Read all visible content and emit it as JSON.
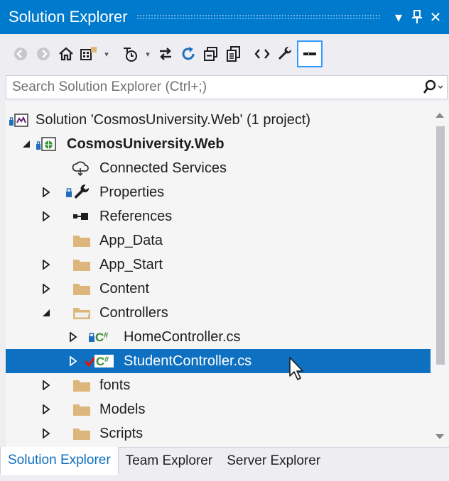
{
  "window": {
    "title": "Solution Explorer",
    "buttons": {
      "dropdown": "▾",
      "pin": "⊥",
      "close": "✕"
    }
  },
  "toolbar": {
    "icons": [
      "back-icon",
      "forward-icon",
      "home-icon",
      "switch-views-icon",
      "pending-changes-filter-icon",
      "sync-with-active-document-icon",
      "refresh-icon",
      "collapse-all-icon",
      "show-all-files-icon",
      "view-code-icon",
      "properties-icon",
      "preview-selected-items-icon"
    ]
  },
  "search": {
    "placeholder": "Search Solution Explorer (Ctrl+;)"
  },
  "tree": {
    "items": [
      {
        "label": "Solution 'CosmosUniversity.Web' (1 project)",
        "icon": "solution-icon",
        "expander": "none"
      },
      {
        "label": "CosmosUniversity.Web",
        "icon": "web-project-icon",
        "expander": "expanded"
      },
      {
        "label": "Connected Services",
        "icon": "connected-services-icon",
        "expander": "none"
      },
      {
        "label": "Properties",
        "icon": "wrench-icon",
        "expander": "collapsed"
      },
      {
        "label": "References",
        "icon": "references-icon",
        "expander": "collapsed"
      },
      {
        "label": "App_Data",
        "icon": "folder-icon",
        "expander": "none"
      },
      {
        "label": "App_Start",
        "icon": "folder-icon",
        "expander": "collapsed"
      },
      {
        "label": "Content",
        "icon": "folder-icon",
        "expander": "collapsed"
      },
      {
        "label": "Controllers",
        "icon": "folder-open-icon",
        "expander": "expanded"
      },
      {
        "label": "HomeController.cs",
        "icon": "csharp-file-icon",
        "expander": "collapsed"
      },
      {
        "label": "StudentController.cs",
        "icon": "csharp-file-icon",
        "expander": "collapsed",
        "selected": true
      },
      {
        "label": "fonts",
        "icon": "folder-icon",
        "expander": "collapsed"
      },
      {
        "label": "Models",
        "icon": "folder-icon",
        "expander": "collapsed"
      },
      {
        "label": "Scripts",
        "icon": "folder-icon",
        "expander": "collapsed"
      }
    ]
  },
  "tabs": [
    {
      "label": "Solution Explorer",
      "active": true
    },
    {
      "label": "Team Explorer",
      "active": false
    },
    {
      "label": "Server Explorer",
      "active": false
    }
  ],
  "colors": {
    "accent": "#007acc",
    "selection": "#0e70c0",
    "folder": "#dcb67a",
    "csharp": "#388a34",
    "checked_out": "#e51400"
  }
}
